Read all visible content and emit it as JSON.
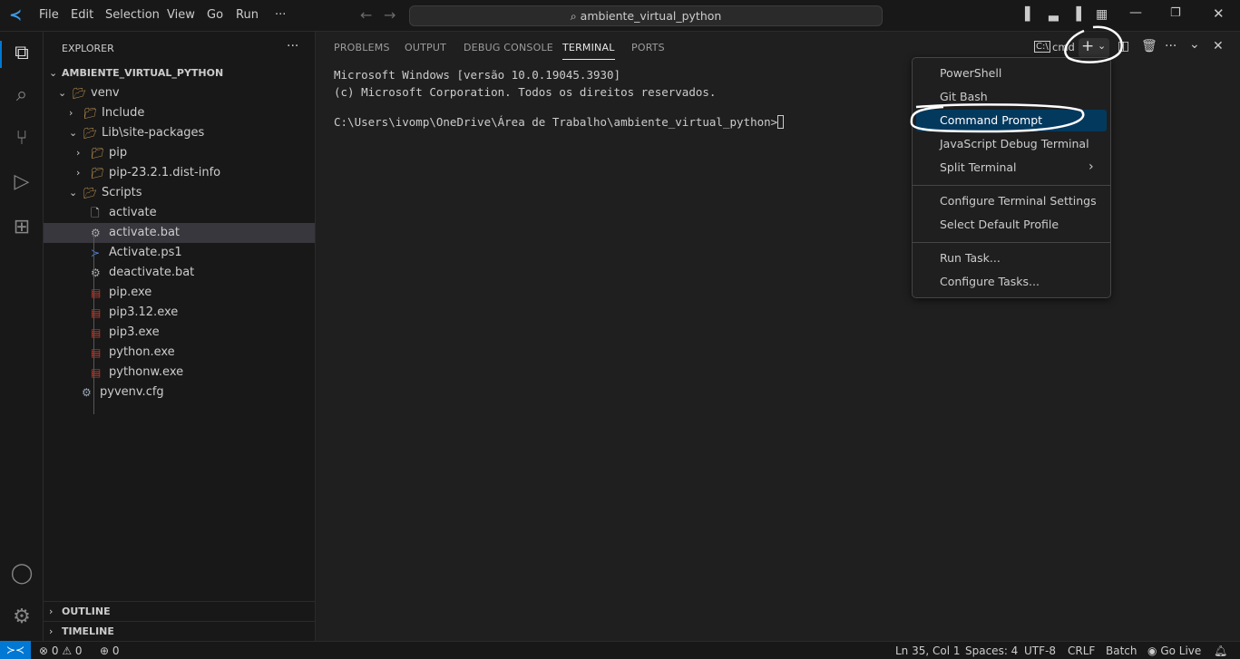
{
  "titlebar": {
    "menu": [
      "File",
      "Edit",
      "Selection",
      "View",
      "Go",
      "Run",
      "···"
    ],
    "search": "ambiente_virtual_python"
  },
  "sidebar": {
    "title": "EXPLORER",
    "more": "···",
    "root": "AMBIENTE_VIRTUAL_PYTHON",
    "items": [
      {
        "label": "venv",
        "type": "folder-open"
      },
      {
        "label": "Include",
        "type": "folder"
      },
      {
        "label": "Lib\\site-packages",
        "type": "folder-open"
      },
      {
        "label": "pip",
        "type": "folder"
      },
      {
        "label": "pip-23.2.1.dist-info",
        "type": "folder"
      },
      {
        "label": "Scripts",
        "type": "folder-open"
      },
      {
        "label": "activate",
        "type": "file"
      },
      {
        "label": "activate.bat",
        "type": "gear-file",
        "selected": true
      },
      {
        "label": "Activate.ps1",
        "type": "powershell"
      },
      {
        "label": "deactivate.bat",
        "type": "gear-file"
      },
      {
        "label": "pip.exe",
        "type": "exe"
      },
      {
        "label": "pip3.12.exe",
        "type": "exe"
      },
      {
        "label": "pip3.exe",
        "type": "exe"
      },
      {
        "label": "python.exe",
        "type": "exe"
      },
      {
        "label": "pythonw.exe",
        "type": "exe"
      },
      {
        "label": "pyvenv.cfg",
        "type": "gear"
      }
    ],
    "outline": "OUTLINE",
    "timeline": "TIMELINE"
  },
  "panel": {
    "tabs": [
      "PROBLEMS",
      "OUTPUT",
      "DEBUG CONSOLE",
      "TERMINAL",
      "PORTS"
    ],
    "active_tab": "TERMINAL",
    "terminal_name": "cmd",
    "lines": [
      "Microsoft Windows [versão 10.0.19045.3930]",
      "(c) Microsoft Corporation. Todos os direitos reservados.",
      "",
      "C:\\Users\\ivomp\\OneDrive\\Área de Trabalho\\ambiente_virtual_python>"
    ]
  },
  "dropdown": {
    "groups": [
      [
        "PowerShell",
        "Git Bash",
        "Command Prompt",
        "JavaScript Debug Terminal",
        "Split Terminal"
      ],
      [
        "Configure Terminal Settings",
        "Select Default Profile"
      ],
      [
        "Run Task...",
        "Configure Tasks..."
      ]
    ],
    "highlighted": "Command Prompt"
  },
  "statusbar": {
    "errors": "0",
    "warnings": "0",
    "ports": "0",
    "position": "Ln 35, Col 1",
    "spaces": "Spaces: 4",
    "encoding": "UTF-8",
    "eol": "CRLF",
    "language": "Batch",
    "golive": "Go Live"
  },
  "colors": {
    "accent": "#0078d4",
    "highlight": "#04395e",
    "annotation": "#ffffff"
  }
}
